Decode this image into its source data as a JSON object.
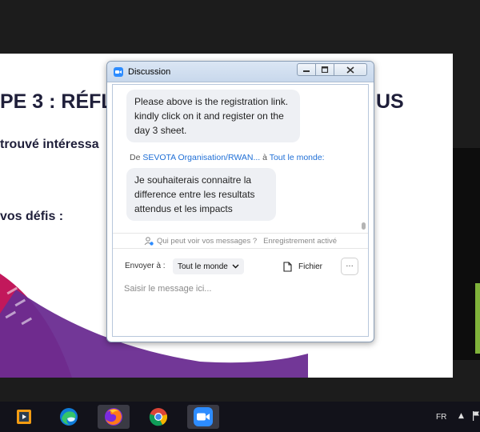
{
  "slide": {
    "title_left": "PE 3 : RÉFL",
    "title_right": "US",
    "line1": "trouvé intéressa",
    "line2": "vos défis :"
  },
  "chat": {
    "window_title": "Discussion",
    "messages": [
      {
        "text": "Please above is the registration link. kindly click on it and register on the day 3 sheet."
      }
    ],
    "sender": {
      "prefix": "De",
      "name": "SEVOTA Organisation/RWAN...",
      "to_word": "à",
      "recipient": "Tout le monde:"
    },
    "message2": "Je souhaiterais connaitre la difference entre les resultats attendus et les impacts",
    "privacy": {
      "who_can_see": "Qui peut voir vos messages ?",
      "recording": "Enregistrement activé"
    },
    "send_to_label": "Envoyer à :",
    "recipient_select": "Tout le monde",
    "file_label": "Fichier",
    "more_label": "···",
    "input_placeholder": "Saisir le message ici..."
  },
  "taskbar": {
    "language": "FR",
    "tray_arrow": "▲"
  },
  "colors": {
    "link_blue": "#1f6fd6",
    "zoom_blue": "#2d8cff",
    "bubble_bg": "#eef0f4",
    "slide_purple": "#6a2c91",
    "slide_magenta": "#c2185b"
  }
}
